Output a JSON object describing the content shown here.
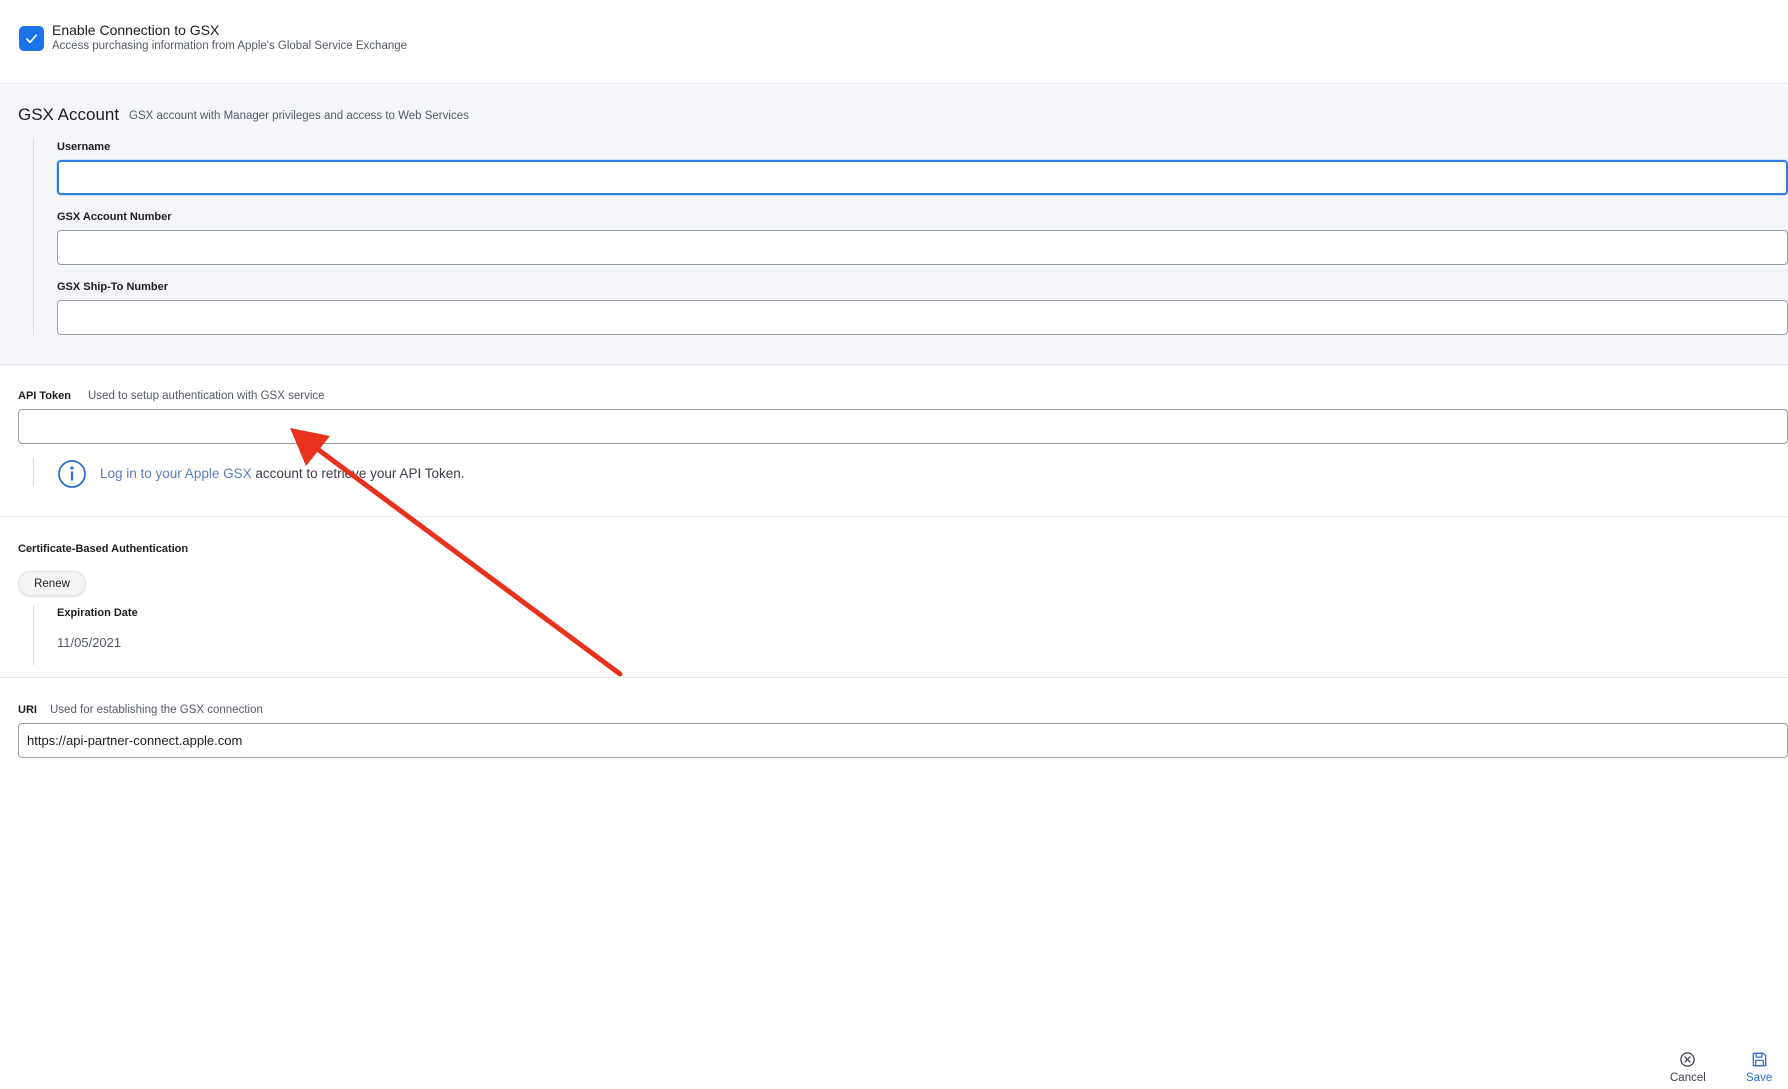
{
  "enable": {
    "title": "Enable Connection to GSX",
    "subtitle": "Access purchasing information from Apple's Global Service Exchange",
    "checked": true
  },
  "gsx_account": {
    "title": "GSX Account",
    "subtitle": "GSX account with Manager privileges and access to Web Services",
    "username": {
      "label": "Username",
      "value": ""
    },
    "account_number": {
      "label": "GSX Account Number",
      "value": ""
    },
    "ship_to": {
      "label": "GSX Ship-To Number",
      "value": ""
    }
  },
  "api_token": {
    "label": "API Token",
    "subtitle": "Used to setup authentication with GSX service",
    "value": "",
    "info_link": "Log in to your Apple GSX",
    "info_rest": " account to retrieve your API Token."
  },
  "certificate": {
    "title": "Certificate-Based Authentication",
    "renew_label": "Renew",
    "expiration_label": "Expiration Date",
    "expiration_value": "11/05/2021"
  },
  "uri": {
    "label": "URI",
    "subtitle": "Used for establishing the GSX connection",
    "value": "https://api-partner-connect.apple.com"
  },
  "actions": {
    "cancel_label": "Cancel",
    "save_label": "Save"
  },
  "colors": {
    "accent": "#1a73e8",
    "focus": "#2f7fe0",
    "link": "#5b7fb8",
    "annotation_arrow": "#e8321e",
    "section_bg": "#f5f6f9"
  },
  "icons": {
    "checkbox": "checkmark-icon",
    "info": "info-circle-icon",
    "cancel": "close-circle-icon",
    "save": "floppy-disk-icon"
  }
}
